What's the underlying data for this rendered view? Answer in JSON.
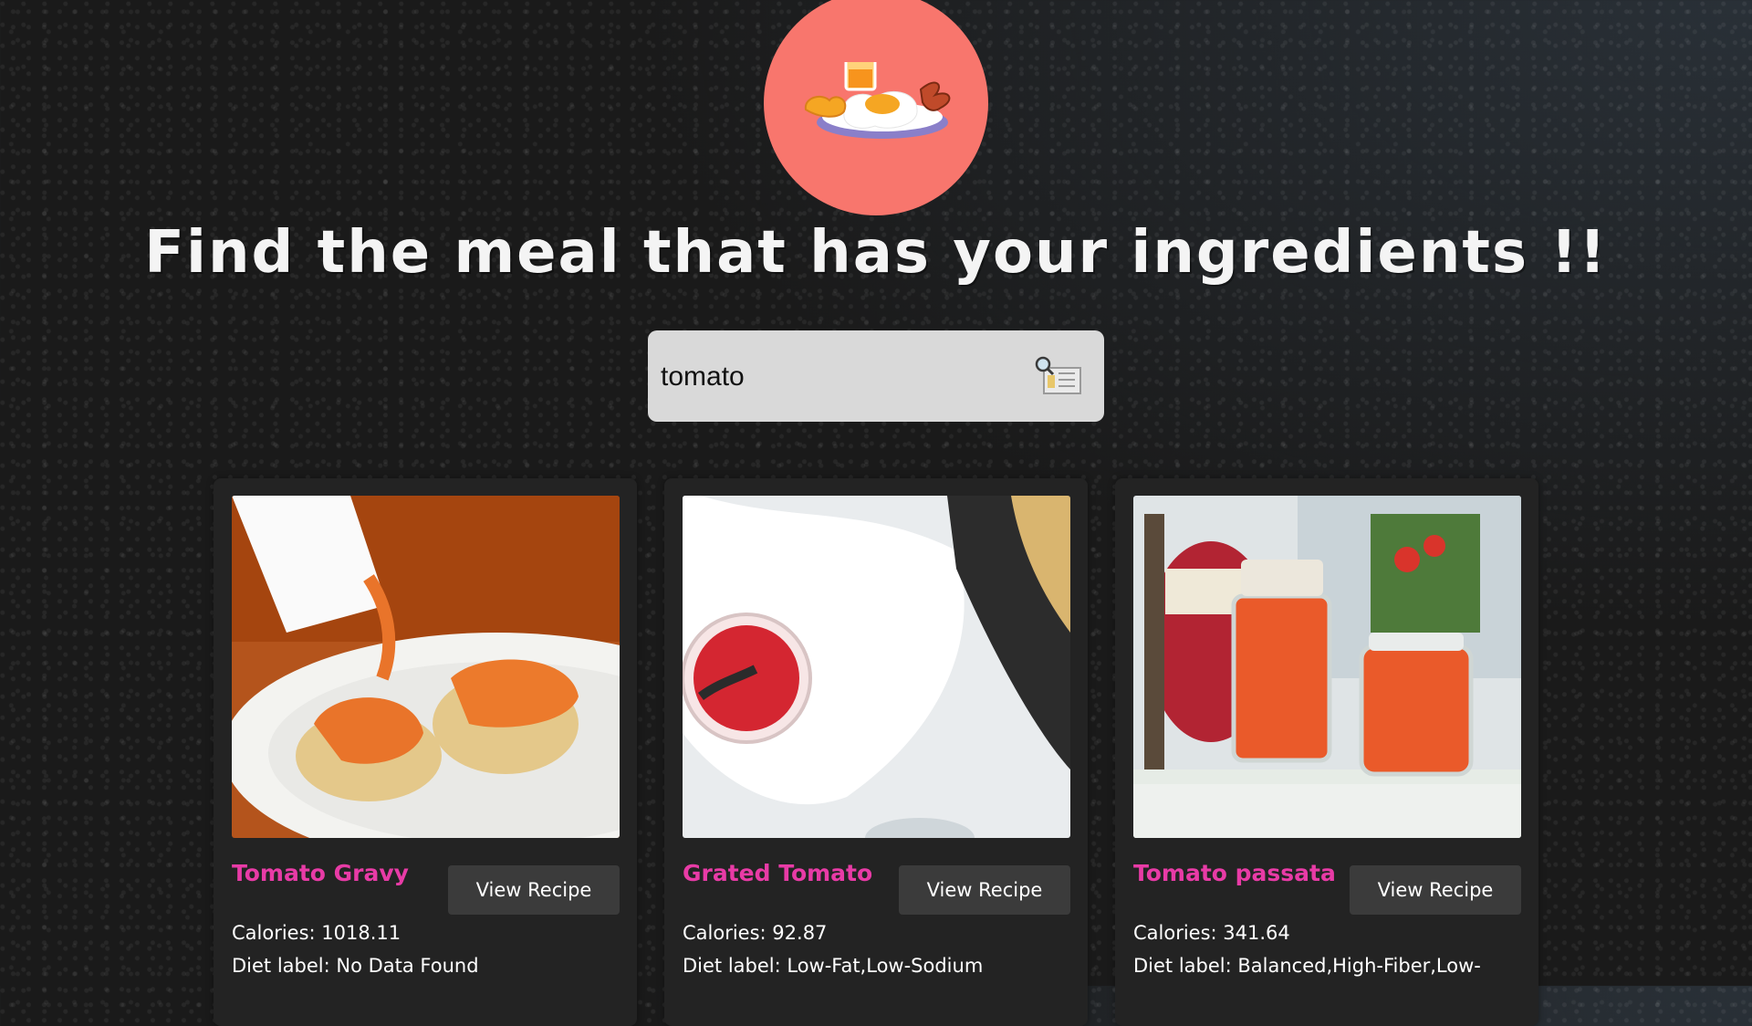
{
  "header": {
    "logo_icon": "breakfast-plate-icon",
    "title": "Find the meal that has your ingredients !!"
  },
  "search": {
    "value": "tomato",
    "icon": "search-icon"
  },
  "recipes": [
    {
      "title": "Tomato Gravy",
      "button": "View Recipe",
      "calories": "Calories: 1018.11",
      "diet": "Diet label: No Data Found"
    },
    {
      "title": "Grated Tomato",
      "button": "View Recipe",
      "calories": "Calories: 92.87",
      "diet": "Diet label: Low-Fat,Low-Sodium"
    },
    {
      "title": "Tomato passata",
      "button": "View Recipe",
      "calories": "Calories: 341.64",
      "diet": "Diet label: Balanced,High-Fiber,Low-"
    }
  ],
  "colors": {
    "logo_bg": "#f8766d",
    "recipe_title": "#e83ba6",
    "card_bg": "#232323",
    "button_bg": "#3b3b3b"
  }
}
